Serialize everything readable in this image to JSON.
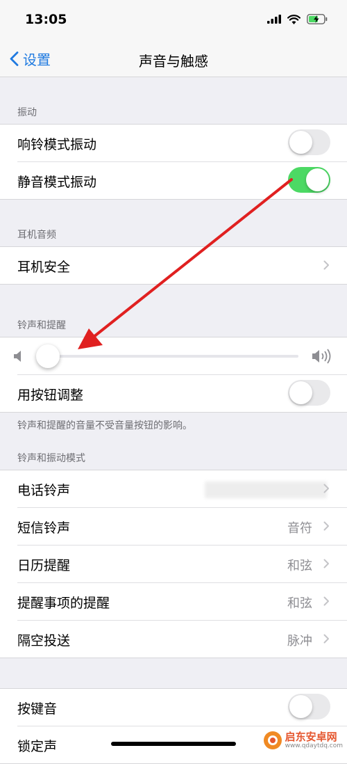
{
  "status": {
    "time": "13:05"
  },
  "nav": {
    "back_label": "设置",
    "title": "声音与触感"
  },
  "sections": {
    "vibration": {
      "header": "振动",
      "rows": [
        {
          "label": "响铃模式振动",
          "toggle": false
        },
        {
          "label": "静音模式振动",
          "toggle": true
        }
      ]
    },
    "headphone": {
      "header": "耳机音频",
      "rows": [
        {
          "label": "耳机安全"
        }
      ]
    },
    "ringer": {
      "header": "铃声和提醒",
      "volume_level": 0.02,
      "adjust_label": "用按钮调整",
      "adjust_toggle": false,
      "note": "铃声和提醒的音量不受音量按钮的影响。"
    },
    "patterns": {
      "header": "铃声和振动模式",
      "rows": [
        {
          "label": "电话铃声",
          "value": ""
        },
        {
          "label": "短信铃声",
          "value": "音符"
        },
        {
          "label": "日历提醒",
          "value": "和弦"
        },
        {
          "label": "提醒事项的提醒",
          "value": "和弦"
        },
        {
          "label": "隔空投送",
          "value": "脉冲"
        }
      ]
    },
    "sounds": {
      "rows": [
        {
          "label": "按键音",
          "toggle": false
        },
        {
          "label": "锁定声"
        }
      ]
    }
  },
  "watermark": {
    "name": "启东安卓网",
    "url": "www.qdaytdq.com"
  },
  "colors": {
    "accent": "#1f7ae0",
    "toggle_on": "#4cd964",
    "annotation_arrow": "#e02020"
  }
}
